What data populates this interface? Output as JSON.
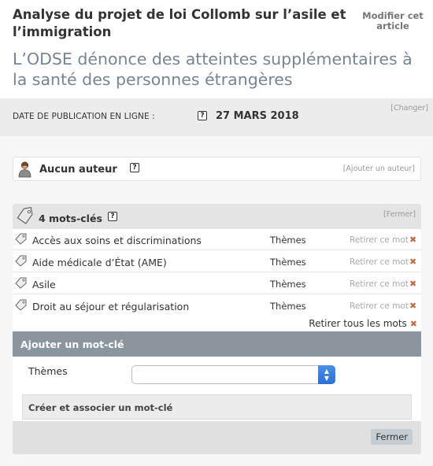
{
  "header": {
    "surtitre": "Analyse du projet de loi Collomb sur l’asile et l’immigration",
    "titre": "L’ODSE dénonce des atteintes supplémentaires à la santé des personnes étrangères",
    "modifier_label": "Modifier cet article"
  },
  "date": {
    "label": "DATE DE PUBLICATION EN LIGNE :",
    "help": "?",
    "value": "27 MARS 2018",
    "changer": "[Changer]"
  },
  "auteur": {
    "label": "Aucun auteur",
    "help": "?",
    "ajouter": "[Ajouter un auteur]"
  },
  "mots": {
    "title": "4 mots-clés",
    "help": "?",
    "fermer": "[Fermer]",
    "retirer_label": "Retirer ce mot",
    "items": [
      {
        "label": "Accès aux soins et discriminations",
        "groupe": "Thèmes"
      },
      {
        "label": "Aide médicale d’État (AME)",
        "groupe": "Thèmes"
      },
      {
        "label": "Asile",
        "groupe": "Thèmes"
      },
      {
        "label": "Droit au séjour et régularisation",
        "groupe": "Thèmes"
      }
    ],
    "retirer_tous": "Retirer tous les mots",
    "ajouter_title": "Ajouter un mot-clé",
    "themes_label": "Thèmes",
    "select_value": "",
    "creer_label": "Créer et associer un mot-clé",
    "fermer_button": "Fermer"
  },
  "colors": {
    "accent_remove": "#c76b3e",
    "section_header": "#8a959e",
    "title_grey": "#778591",
    "select_blue": "#2b6fd6"
  }
}
